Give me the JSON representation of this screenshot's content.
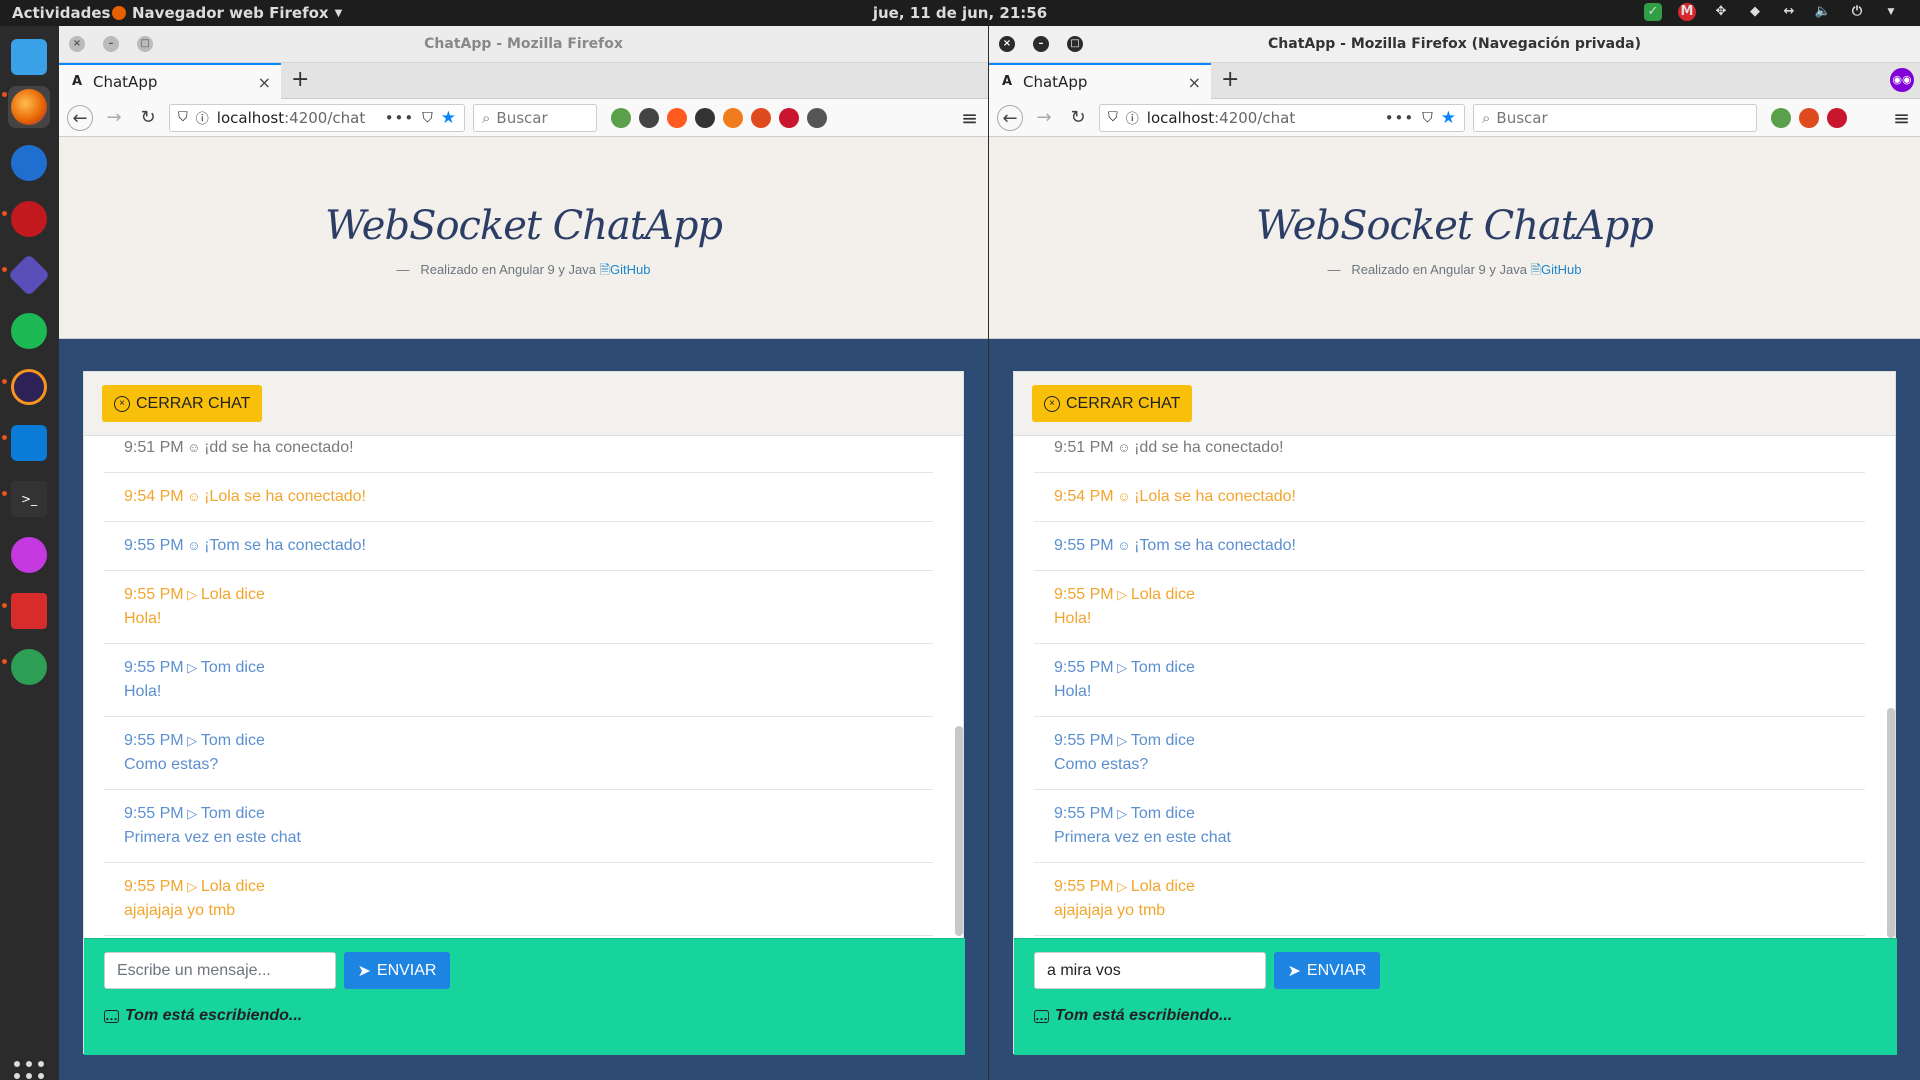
{
  "desktop": {
    "activities": "Actividades",
    "app_menu": "Navegador web Firefox",
    "clock": "jue, 11 de jun, 21:56"
  },
  "windows": [
    {
      "title": "ChatApp - Mozilla Firefox",
      "tab_label": "ChatApp",
      "url_host": "localhost",
      "url_path": ":4200/chat",
      "search_placeholder": "Buscar",
      "input_value": "",
      "input_placeholder": "Escribe un mensaje..."
    },
    {
      "title": "ChatApp - Mozilla Firefox (Navegación privada)",
      "tab_label": "ChatApp",
      "url_host": "localhost",
      "url_path": ":4200/chat",
      "search_placeholder": "Buscar",
      "input_value": "a mira vos",
      "input_placeholder": "Escribe un mensaje..."
    }
  ],
  "app": {
    "title": "WebSocket ChatApp",
    "subtitle_prefix": "—",
    "subtitle": "Realizado en Angular 9 y Java",
    "github_link": "GitHub",
    "close_button": "CERRAR CHAT",
    "send_button": "ENVIAR",
    "typing_status": "Tom está escribiendo..."
  },
  "messages": [
    {
      "time": "9:51 PM",
      "icon": "smile",
      "text": "¡dd se ha conectado!",
      "color": "#7a7a7a",
      "body": ""
    },
    {
      "time": "9:54 PM",
      "icon": "smile",
      "text": "¡Lola se ha conectado!",
      "color": "#f2a52e",
      "body": ""
    },
    {
      "time": "9:55 PM",
      "icon": "smile",
      "text": "¡Tom se ha conectado!",
      "color": "#5b8fcf",
      "body": ""
    },
    {
      "time": "9:55 PM",
      "icon": "play",
      "text": "Lola dice",
      "color": "#f2a52e",
      "body": "Hola!"
    },
    {
      "time": "9:55 PM",
      "icon": "play",
      "text": "Tom dice",
      "color": "#5b8fcf",
      "body": "Hola!"
    },
    {
      "time": "9:55 PM",
      "icon": "play",
      "text": "Tom dice",
      "color": "#5b8fcf",
      "body": "Como estas?"
    },
    {
      "time": "9:55 PM",
      "icon": "play",
      "text": "Tom dice",
      "color": "#5b8fcf",
      "body": "Primera vez en este chat"
    },
    {
      "time": "9:55 PM",
      "icon": "play",
      "text": "Lola dice",
      "color": "#f2a52e",
      "body": "ajajajaja yo tmb"
    }
  ],
  "colors": {
    "page_bg": "#2e4b73",
    "footer_bg": "#17d39c",
    "close_btn": "#f8c00a",
    "send_btn": "#1d84e2",
    "dock_bg": "#2b2b2b"
  },
  "dock_icons": [
    "finder-icon",
    "firefox-icon",
    "thunderbird-icon",
    "cherry-icon",
    "vs-icon",
    "spotify-icon",
    "eclipse-icon",
    "vscode-icon",
    "terminal-icon",
    "media-player-icon",
    "red-terminal-icon",
    "rocket-icon"
  ]
}
